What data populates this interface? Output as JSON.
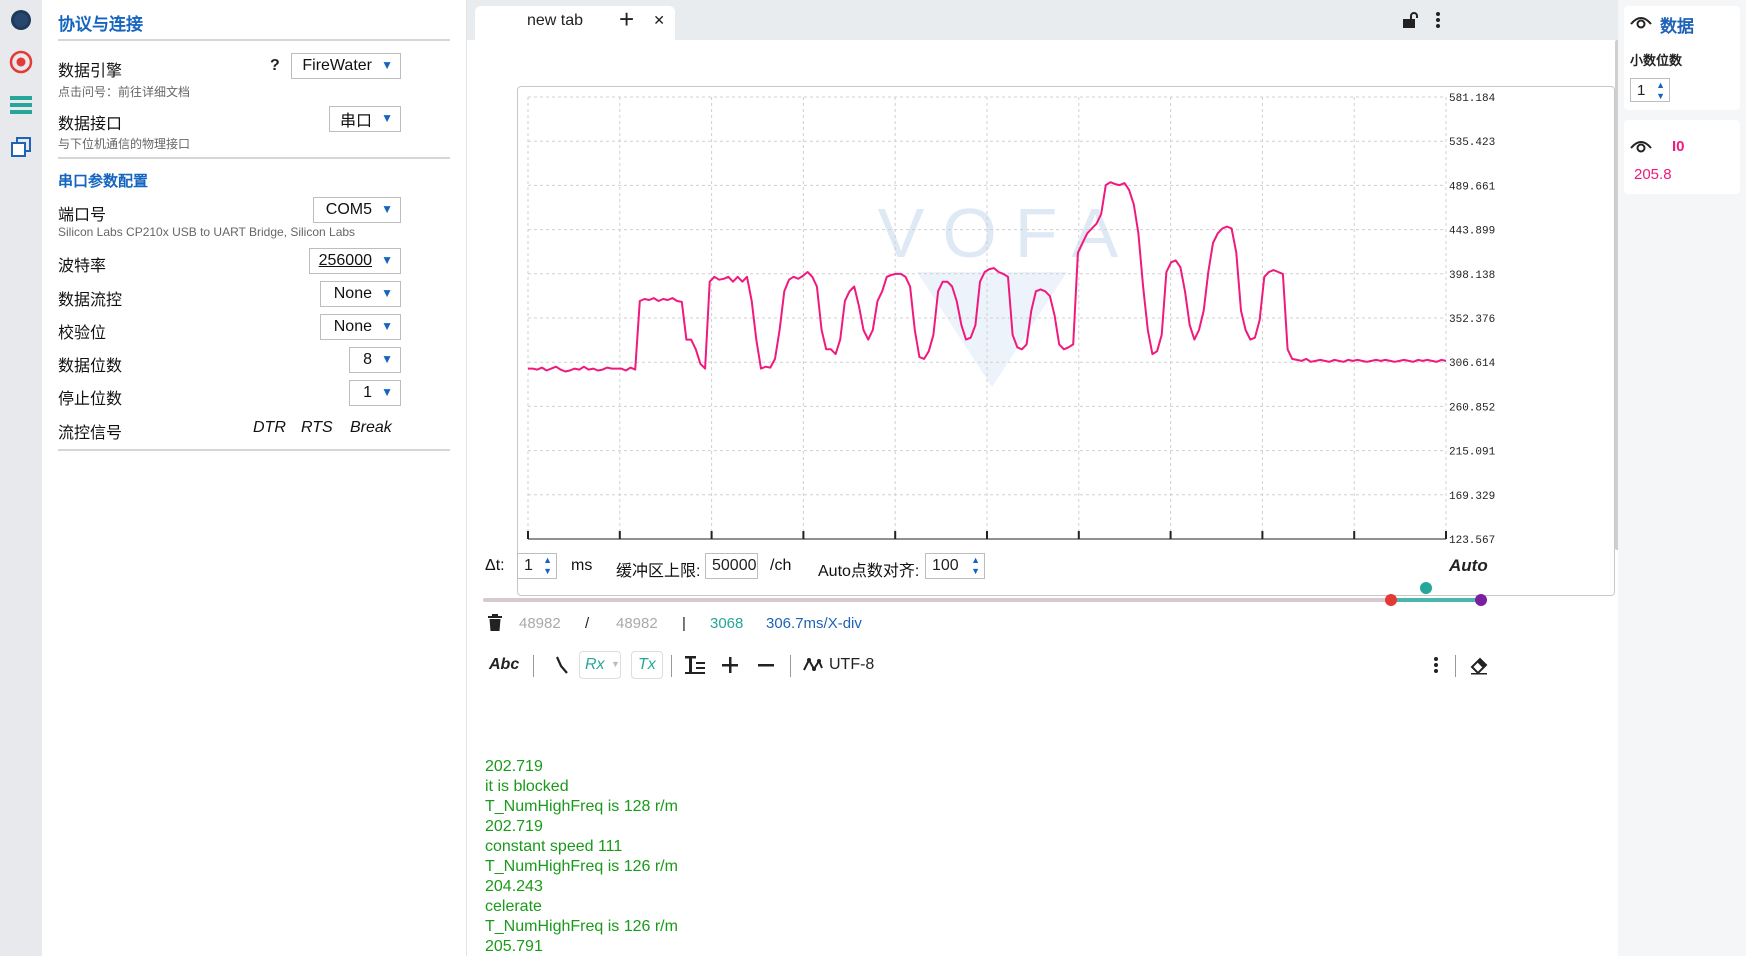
{
  "rail": {
    "icons": [
      "connection-status-icon",
      "record-icon",
      "list-icon",
      "windows-icon"
    ]
  },
  "config": {
    "section1_title": "协议与连接",
    "engine_label": "数据引擎",
    "engine_help": "?",
    "engine_value": "FireWater",
    "engine_sub": "点击问号：前往详细文档",
    "interface_label": "数据接口",
    "interface_value": "串口",
    "interface_sub": "与下位机通信的物理接口",
    "section2_title": "串口参数配置",
    "port_label": "端口号",
    "port_value": "COM5",
    "port_sub": "Silicon Labs CP210x USB to UART Bridge, Silicon Labs",
    "baud_label": "波特率",
    "baud_value": "256000",
    "flow_ctrl_label": "数据流控",
    "flow_ctrl_value": "None",
    "parity_label": "校验位",
    "parity_value": "None",
    "databits_label": "数据位数",
    "databits_value": "8",
    "stopbits_label": "停止位数",
    "stopbits_value": "1",
    "signals_label": "流控信号",
    "signals": [
      "DTR",
      "RTS",
      "Break"
    ]
  },
  "tabbar": {
    "tab_label": "new tab",
    "close_glyph": "✕",
    "add_glyph": "+"
  },
  "chart_data": {
    "type": "line",
    "title": "",
    "xlabel": "",
    "ylabel": "",
    "ylim": [
      123.567,
      581.184
    ],
    "yticks": [
      "581.184",
      "535.423",
      "489.661",
      "443.899",
      "398.138",
      "352.376",
      "306.614",
      "260.852",
      "215.091",
      "169.329",
      "123.567"
    ],
    "x_tick_count": 11,
    "grid": true,
    "legend": "right-panel",
    "watermark": "VOFA",
    "series": [
      {
        "name": "I0",
        "color": "#f0197d",
        "values": [
          300,
          300,
          299,
          301,
          298,
          300,
          302,
          299,
          297,
          298,
          300,
          299,
          302,
          299,
          300,
          298,
          299,
          301,
          300,
          300,
          300,
          298,
          301,
          299,
          370,
          372,
          371,
          373,
          370,
          372,
          371,
          373,
          370,
          369,
          330,
          330,
          320,
          305,
          300,
          390,
          395,
          392,
          393,
          395,
          390,
          395,
          390,
          395,
          370,
          330,
          300,
          302,
          301,
          310,
          340,
          380,
          392,
          395,
          393,
          396,
          400,
          395,
          385,
          340,
          320,
          320,
          315,
          330,
          370,
          380,
          385,
          365,
          340,
          330,
          340,
          370,
          380,
          395,
          397,
          398,
          398,
          395,
          385,
          340,
          312,
          310,
          318,
          335,
          380,
          390,
          390,
          385,
          370,
          345,
          330,
          332,
          345,
          390,
          400,
          403,
          404,
          400,
          398,
          395,
          335,
          322,
          320,
          325,
          360,
          380,
          382,
          380,
          375,
          355,
          325,
          320,
          322,
          325,
          420,
          430,
          440,
          445,
          450,
          460,
          490,
          493,
          491,
          490,
          492,
          485,
          470,
          440,
          385,
          340,
          315,
          318,
          335,
          400,
          410,
          412,
          405,
          380,
          345,
          330,
          340,
          360,
          400,
          430,
          440,
          445,
          447,
          445,
          420,
          360,
          340,
          330,
          332,
          350,
          395,
          400,
          402,
          400,
          398,
          320,
          310,
          309,
          308,
          310,
          307,
          308,
          309,
          308,
          307,
          309,
          308,
          307,
          309,
          308,
          309,
          308,
          307,
          308,
          309,
          308,
          309,
          308,
          307,
          308,
          309,
          308,
          307,
          309,
          308,
          309,
          308,
          307,
          309,
          308
        ]
      }
    ]
  },
  "controls": {
    "dt_label": "Δt:",
    "dt_value": "1",
    "dt_unit": "ms",
    "buffer_label": "缓冲区上限:",
    "buffer_value": "50000",
    "buffer_unit": "/ch",
    "auto_align_label": "Auto点数对齐:",
    "auto_align_value": "100",
    "auto_label": "Auto",
    "slider_position": 0.96
  },
  "stats": {
    "count_a": "48982",
    "slash": "/",
    "count_b": "48982",
    "bar": "|",
    "points": "3068",
    "per_div": "306.7ms/X-div"
  },
  "toolbar2": {
    "abc": "Abc",
    "rx": "Rx",
    "tx": "Tx",
    "encoding": "UTF-8"
  },
  "console": {
    "lines": [
      "202.719",
      "it is blocked",
      "T_NumHighFreq is 128 r/m",
      "202.719",
      "constant speed 111",
      "T_NumHighFreq is 126 r/m",
      "204.243",
      "celerate",
      "T_NumHighFreq is 126 r/m",
      "205.791"
    ]
  },
  "right": {
    "title": "数据",
    "decimals_label": "小数位数",
    "decimals_value": "1",
    "channel_name": "I0",
    "channel_value": "205.8",
    "channel_color": "#f0197d"
  }
}
